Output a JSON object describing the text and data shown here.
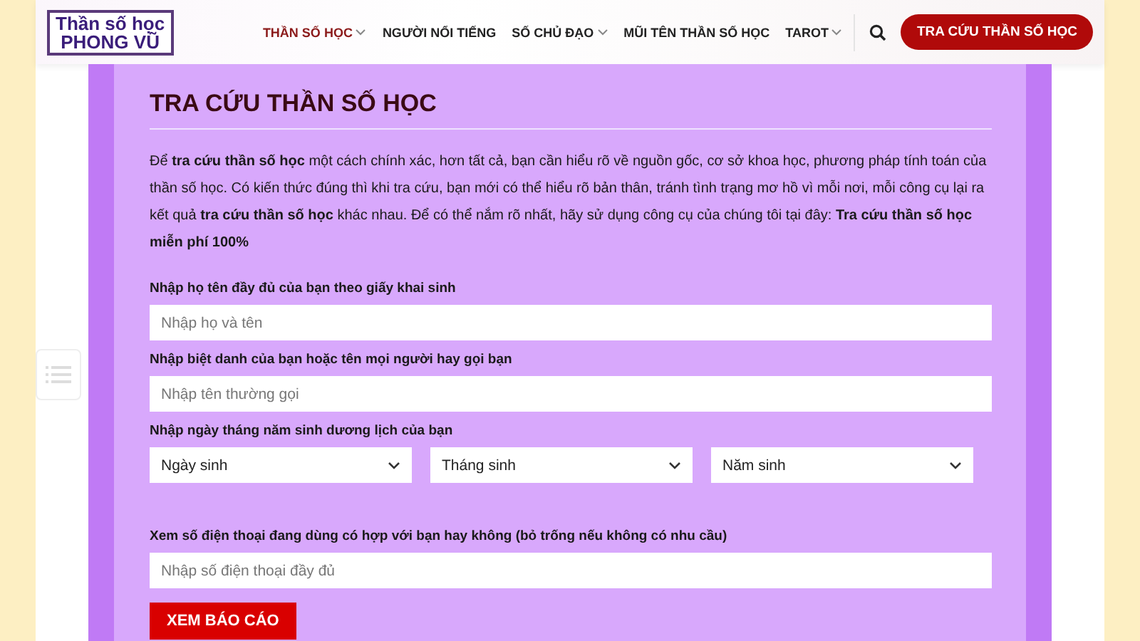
{
  "logo": {
    "line1": "Thần số học",
    "line2": "PHONG VŨ"
  },
  "nav": [
    {
      "label": "THẦN SỐ HỌC",
      "selected": true,
      "has_menu": true
    },
    {
      "label": "NGƯỜI NỔI TIẾNG",
      "selected": false,
      "has_menu": false
    },
    {
      "label": "SỐ CHỦ ĐẠO",
      "selected": false,
      "has_menu": true
    },
    {
      "label": "MŨI TÊN THẦN SỐ HỌC",
      "selected": false,
      "has_menu": false
    },
    {
      "label": "TAROT",
      "selected": false,
      "has_menu": true
    }
  ],
  "cta": "TRA CỨU THẦN SỐ HỌC",
  "form": {
    "title": "TRA CỨU THẦN SỐ HỌC",
    "intro": "Để **tra cứu thần số học** một cách chính xác, hơn tất cả, bạn cần hiểu rõ về nguồn gốc, cơ sở khoa học, phương pháp tính toán của thần số học. Có kiến thức đúng thì khi tra cứu, bạn mới có thể hiểu rõ bản thân, tránh tình trạng mơ hồ vì mỗi nơi, mỗi công cụ lại ra kết quả **tra cứu thần số học** khác nhau. Để có thể nắm rõ nhất, hãy sử dụng công cụ của chúng tôi tại đây: **Tra cứu thần số học miễn phí 100%**",
    "fields": [
      {
        "kind": "text",
        "label": "Nhập họ tên đầy đủ của bạn theo giấy khai sinh",
        "placeholder": "Nhập họ và tên"
      },
      {
        "kind": "text",
        "label": "Nhập biệt danh của bạn hoặc tên mọi người hay gọi bạn",
        "placeholder": "Nhập tên thường gọi"
      },
      {
        "kind": "date",
        "label": "Nhập ngày tháng năm sinh dương lịch của bạn",
        "selects": [
          "Ngày sinh",
          "Tháng sinh",
          "Năm sinh"
        ]
      },
      {
        "kind": "text",
        "label": "Xem số điện thoại đang dùng có hợp với bạn hay không (bỏ trống nếu không có nhu cầu)",
        "placeholder": "Nhập số điện thoại đầy đủ"
      }
    ],
    "submit": "XEM BÁO CÁO"
  }
}
